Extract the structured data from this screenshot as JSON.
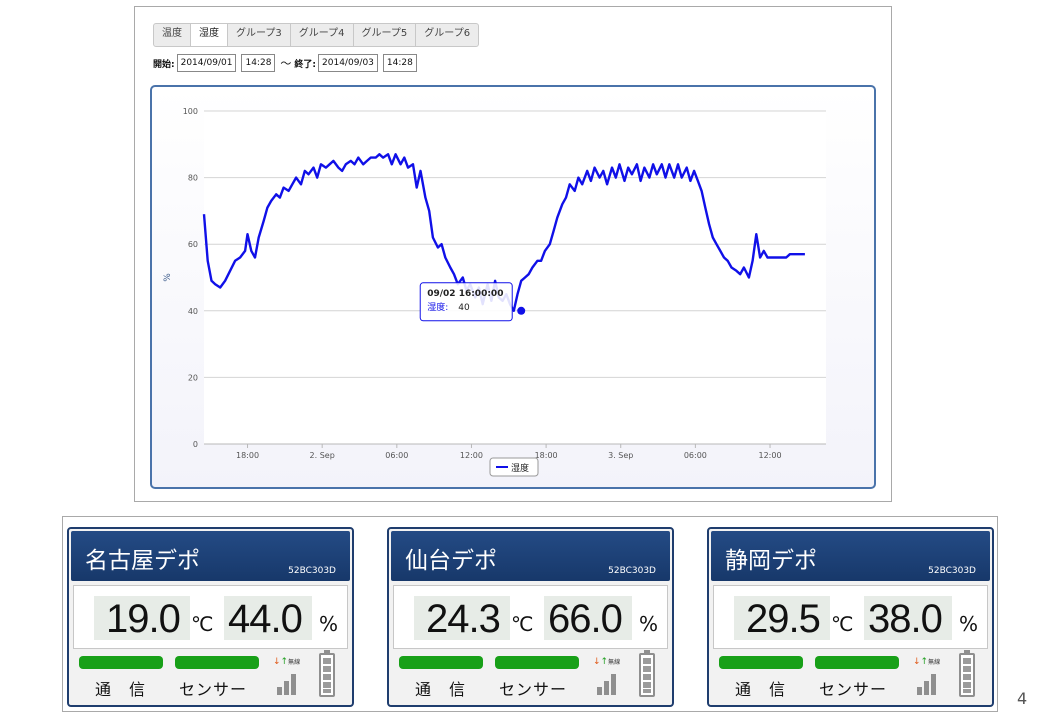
{
  "tabs": [
    {
      "label": "温度",
      "active": false
    },
    {
      "label": "湿度",
      "active": true
    },
    {
      "label": "グループ3",
      "active": false
    },
    {
      "label": "グループ4",
      "active": false
    },
    {
      "label": "グループ5",
      "active": false
    },
    {
      "label": "グループ6",
      "active": false
    }
  ],
  "range": {
    "start_label": "開始:",
    "start_date": "2014/09/01",
    "start_time": "14:28",
    "separator": "～",
    "end_label": "終了:",
    "end_date": "2014/09/03",
    "end_time": "14:28"
  },
  "chart_data": {
    "type": "line",
    "ylabel": "%",
    "ylim": [
      0,
      100
    ],
    "yticks": [
      0,
      20,
      40,
      60,
      80,
      100
    ],
    "xticks": [
      "18:00",
      "2. Sep",
      "06:00",
      "12:00",
      "18:00",
      "3. Sep",
      "06:00",
      "12:00"
    ],
    "xtick_hours": [
      18,
      24,
      30,
      36,
      42,
      48,
      54,
      60
    ],
    "xlim_hours": [
      14.5,
      64.5
    ],
    "grid": true,
    "legend_position": "bottom-center",
    "series": [
      {
        "name": "湿度",
        "color": "#1010e8",
        "x_hours": [
          14.5,
          14.8,
          15.1,
          15.4,
          15.8,
          16.2,
          16.6,
          17.0,
          17.4,
          17.8,
          18.0,
          18.3,
          18.6,
          18.9,
          19.3,
          19.6,
          19.9,
          20.3,
          20.6,
          20.9,
          21.3,
          21.6,
          21.9,
          22.3,
          22.6,
          22.9,
          23.3,
          23.6,
          23.9,
          24.3,
          24.6,
          24.9,
          25.3,
          25.6,
          25.9,
          26.3,
          26.6,
          26.9,
          27.3,
          27.6,
          27.9,
          28.3,
          28.6,
          28.9,
          29.3,
          29.6,
          29.9,
          30.3,
          30.6,
          30.9,
          31.3,
          31.6,
          31.9,
          32.3,
          32.6,
          32.9,
          33.3,
          33.6,
          33.9,
          34.3,
          34.6,
          34.9,
          35.3,
          35.6,
          35.9,
          36.3,
          36.6,
          36.9,
          37.3,
          37.6,
          37.9,
          38.2,
          38.5,
          38.8,
          39.1,
          39.4,
          39.7,
          40.0,
          40.3,
          40.6,
          40.9,
          41.3,
          41.6,
          41.9,
          42.3,
          42.6,
          42.9,
          43.3,
          43.6,
          43.9,
          44.3,
          44.6,
          44.9,
          45.3,
          45.6,
          45.9,
          46.3,
          46.6,
          46.9,
          47.3,
          47.6,
          47.9,
          48.3,
          48.6,
          48.9,
          49.3,
          49.6,
          49.9,
          50.3,
          50.6,
          50.9,
          51.3,
          51.6,
          51.9,
          52.3,
          52.6,
          52.9,
          53.3,
          53.6,
          53.9,
          54.2,
          54.5,
          54.8,
          55.1,
          55.4,
          55.7,
          56.0,
          56.3,
          56.6,
          56.9,
          57.3,
          57.6,
          57.9,
          58.3,
          58.6,
          58.9,
          59.2,
          59.5,
          59.8,
          60.1,
          60.4,
          60.7,
          61.0,
          61.3,
          61.6,
          61.9,
          62.2,
          62.5,
          62.8,
          63.1,
          63.4,
          63.7,
          64.0
        ],
        "y": [
          69,
          55,
          49,
          48,
          47,
          49,
          52,
          55,
          56,
          58,
          63,
          58,
          56,
          62,
          67,
          71,
          73,
          75,
          74,
          77,
          76,
          78,
          80,
          78,
          82,
          81,
          83,
          80,
          84,
          83,
          84,
          85,
          83,
          82,
          84,
          85,
          84,
          86,
          84,
          85,
          86,
          86,
          87,
          86,
          87,
          84,
          87,
          84,
          86,
          83,
          84,
          77,
          82,
          74,
          70,
          62,
          59,
          60,
          56,
          53,
          51,
          48,
          50,
          46,
          48,
          44,
          47,
          42,
          48,
          43,
          49,
          44,
          43,
          45,
          42,
          40,
          45,
          49,
          50,
          51,
          53,
          55,
          55,
          58,
          60,
          64,
          68,
          72,
          74,
          78,
          76,
          80,
          78,
          82,
          79,
          83,
          80,
          82,
          78,
          83,
          80,
          84,
          79,
          83,
          81,
          84,
          79,
          83,
          80,
          84,
          81,
          84,
          80,
          84,
          80,
          84,
          80,
          83,
          79,
          82,
          79,
          76,
          71,
          66,
          62,
          60,
          58,
          56,
          55,
          53,
          52,
          51,
          53,
          50,
          55,
          63,
          56,
          58,
          56,
          56,
          56,
          56,
          56,
          56,
          57,
          57,
          57,
          57,
          57
        ],
        "tooltip": {
          "date": "09/02 16:00:00",
          "series": "湿度",
          "value": 40,
          "x_hours": 40
        }
      }
    ]
  },
  "stations": [
    {
      "name": "名古屋デポ",
      "id": "52BC303D",
      "temp": "19.0",
      "temp_unit": "℃",
      "humidity": "44.0",
      "humidity_unit": "%",
      "comm_label": "通　信",
      "sensor_label": "センサー",
      "wireless_label": "無線"
    },
    {
      "name": "仙台デポ",
      "id": "52BC303D",
      "temp": "24.3",
      "temp_unit": "℃",
      "humidity": "66.0",
      "humidity_unit": "%",
      "comm_label": "通　信",
      "sensor_label": "センサー",
      "wireless_label": "無線"
    },
    {
      "name": "静岡デポ",
      "id": "52BC303D",
      "temp": "29.5",
      "temp_unit": "℃",
      "humidity": "38.0",
      "humidity_unit": "%",
      "comm_label": "通　信",
      "sensor_label": "センサー",
      "wireless_label": "無線"
    }
  ],
  "page_number": "4"
}
